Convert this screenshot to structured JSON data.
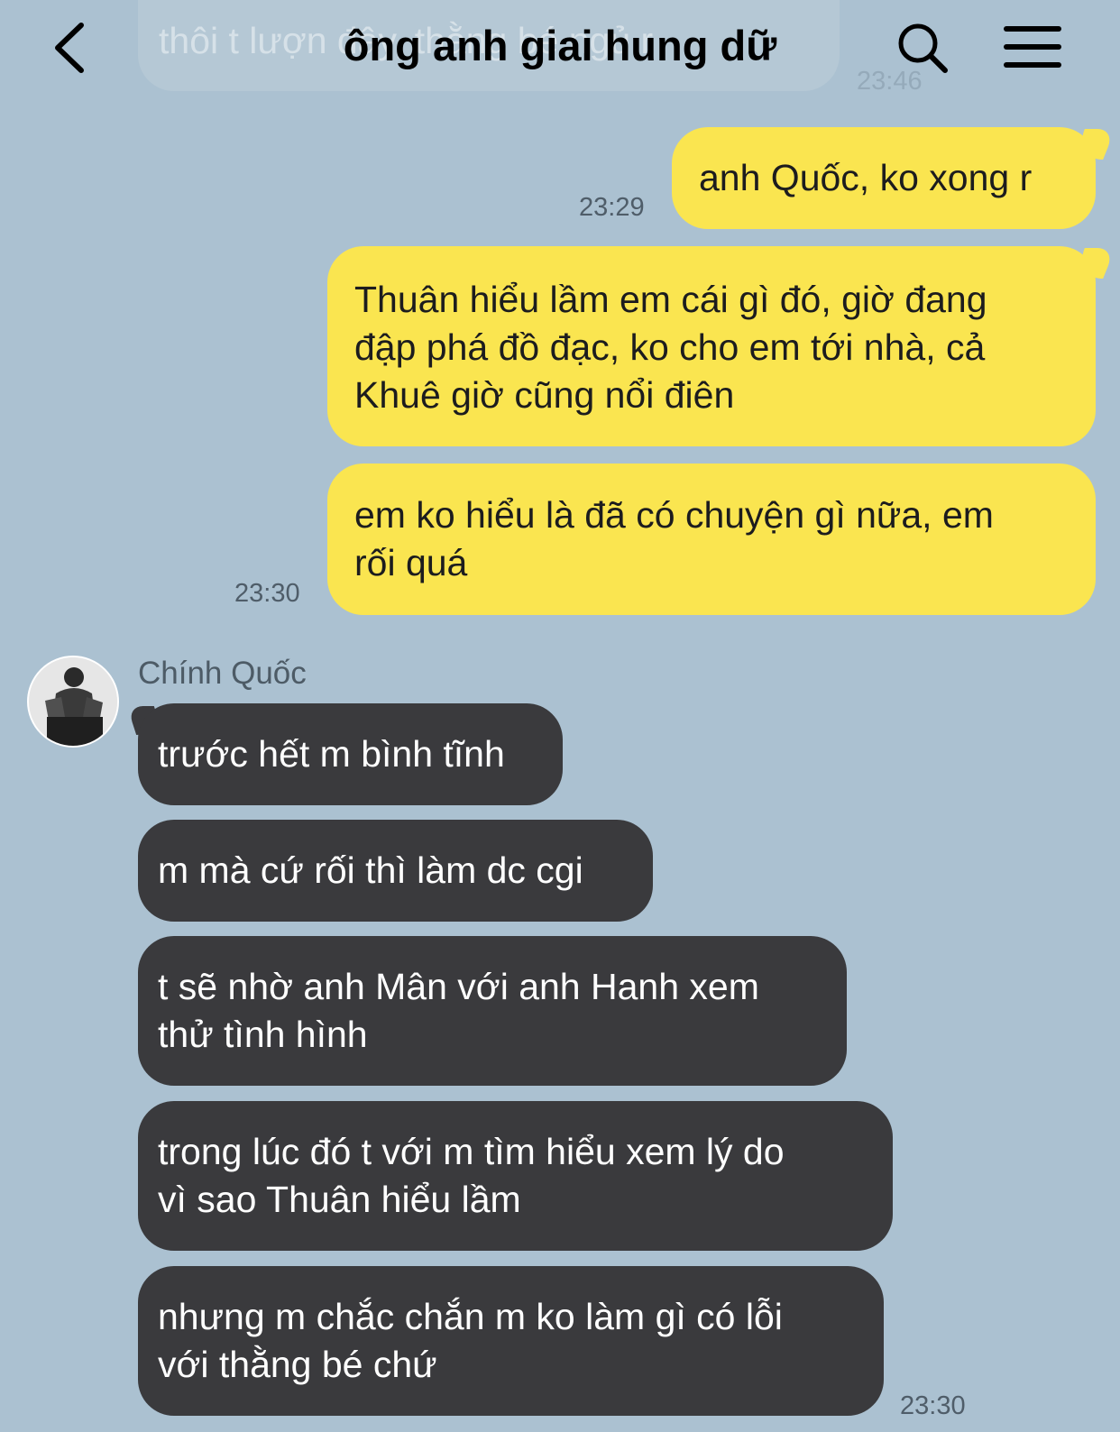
{
  "header": {
    "title": "ông anh giai hung dữ",
    "back_icon": "chevron-left-icon",
    "search_icon": "search-icon",
    "menu_icon": "hamburger-menu-icon",
    "ghost_message": "thôi t lượn đây, thằng bé ngủ r",
    "ghost_time": "23:46"
  },
  "colors": {
    "background": "#abc1d1",
    "outgoing_bubble": "#fae550",
    "incoming_bubble": "#3a3a3d"
  },
  "outgoing": [
    {
      "lines": [
        "anh Quốc, ko xong r"
      ],
      "time": "23:29"
    },
    {
      "lines": [
        "Thuân hiểu lầm em cái gì đó, giờ đang",
        "đập phá đồ đạc, ko cho em tới nhà, cả",
        "Khuê giờ cũng nổi điên"
      ],
      "time": ""
    },
    {
      "lines": [
        "em ko hiểu là đã có chuyện gì nữa, em",
        "rối quá"
      ],
      "time": "23:30"
    }
  ],
  "incoming": {
    "sender": "Chính Quốc",
    "avatar_icon": "profile-photo",
    "messages": [
      {
        "lines": [
          "trước hết m bình tĩnh"
        ]
      },
      {
        "lines": [
          "m mà cứ rối thì làm dc cgi"
        ]
      },
      {
        "lines": [
          "t sẽ nhờ anh Mân với anh Hanh xem",
          "thử tình hình"
        ]
      },
      {
        "lines": [
          "trong lúc đó t với m tìm hiểu xem lý do",
          "vì sao Thuân hiểu lầm"
        ]
      },
      {
        "lines": [
          "nhưng m chắc chắn m ko làm gì có lỗi",
          "với thằng bé chứ"
        ]
      }
    ],
    "time": "23:30"
  }
}
